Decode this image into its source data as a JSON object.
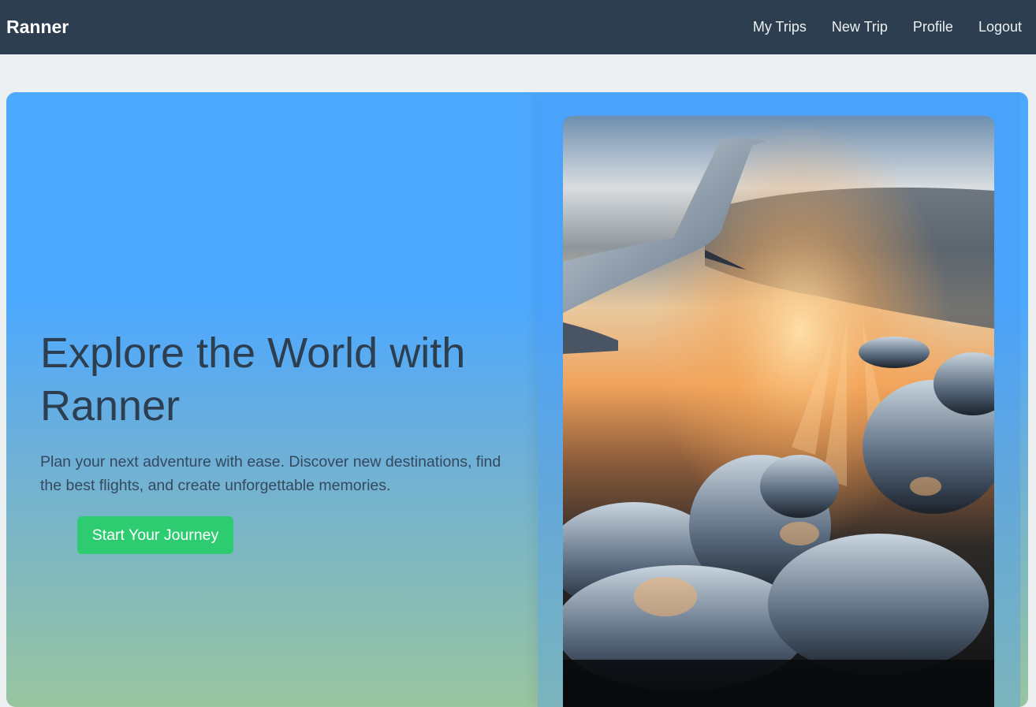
{
  "navbar": {
    "brand": "Ranner",
    "links": [
      {
        "label": "My Trips"
      },
      {
        "label": "New Trip"
      },
      {
        "label": "Profile"
      },
      {
        "label": "Logout"
      }
    ]
  },
  "hero": {
    "title": "Explore the World with Ranner",
    "subtitle": "Plan your next adventure with ease. Discover new destinations, find the best flights, and create unforgettable memories.",
    "cta_label": "Start Your Journey"
  },
  "colors": {
    "navbar_bg": "#2c3e50",
    "page_bg": "#ecf0f1",
    "hero_top": "#4da9ff",
    "hero_bottom": "#99c59f",
    "title_text": "#2c3e50",
    "cta_bg": "#2ecc71"
  }
}
